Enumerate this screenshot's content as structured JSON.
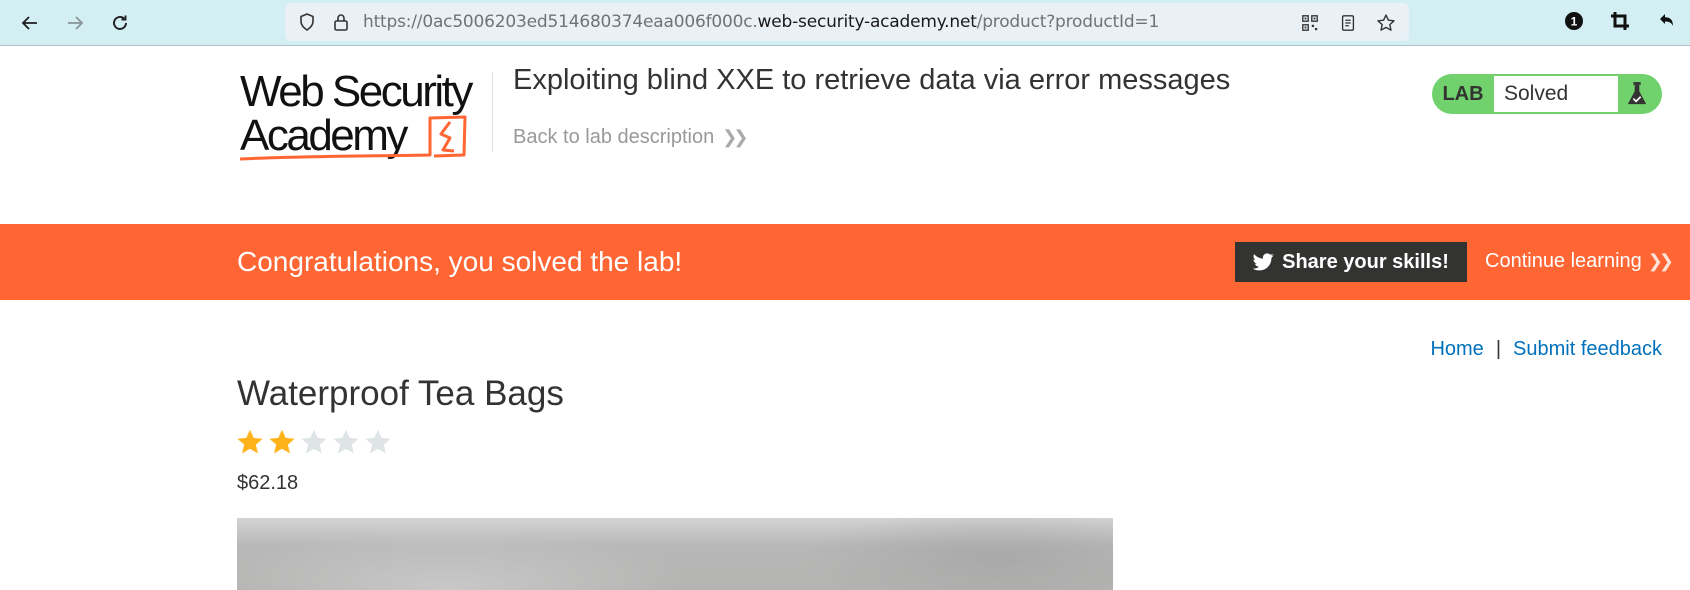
{
  "browser": {
    "url_prefix": "https://0ac5006203ed514680374eaa006f000c.",
    "url_host": "web-security-academy.net",
    "url_path": "/product?productId=1",
    "icons": {
      "back": "arrow-left-icon",
      "forward": "arrow-right-icon",
      "reload": "reload-icon",
      "shield": "shield-icon",
      "lock": "lock-icon",
      "qr": "qr-code-icon",
      "reader": "reader-view-icon",
      "bookmark": "star-icon",
      "extension_badge": "1",
      "crop": "crop-icon",
      "undo": "undo-icon"
    }
  },
  "header": {
    "logo_line1": "Web Security",
    "logo_line2": "Academy",
    "lab_title": "Exploiting blind XXE to retrieve data via error messages",
    "back_link": "Back to lab description",
    "lab_badge_label": "LAB",
    "lab_status": "Solved"
  },
  "banner": {
    "message": "Congratulations, you solved the lab!",
    "share_button": "Share your skills!",
    "continue_link": "Continue learning"
  },
  "top_links": {
    "home": "Home",
    "separator": "|",
    "feedback": "Submit feedback"
  },
  "product": {
    "title": "Waterproof Tea Bags",
    "rating": 2,
    "rating_max": 5,
    "price": "$62.18"
  },
  "colors": {
    "brand_orange": "#ff6633",
    "lab_green": "#70d16d",
    "link_blue": "#0071bc",
    "star_filled": "#ffb21a",
    "star_empty": "#dfe4e6"
  }
}
